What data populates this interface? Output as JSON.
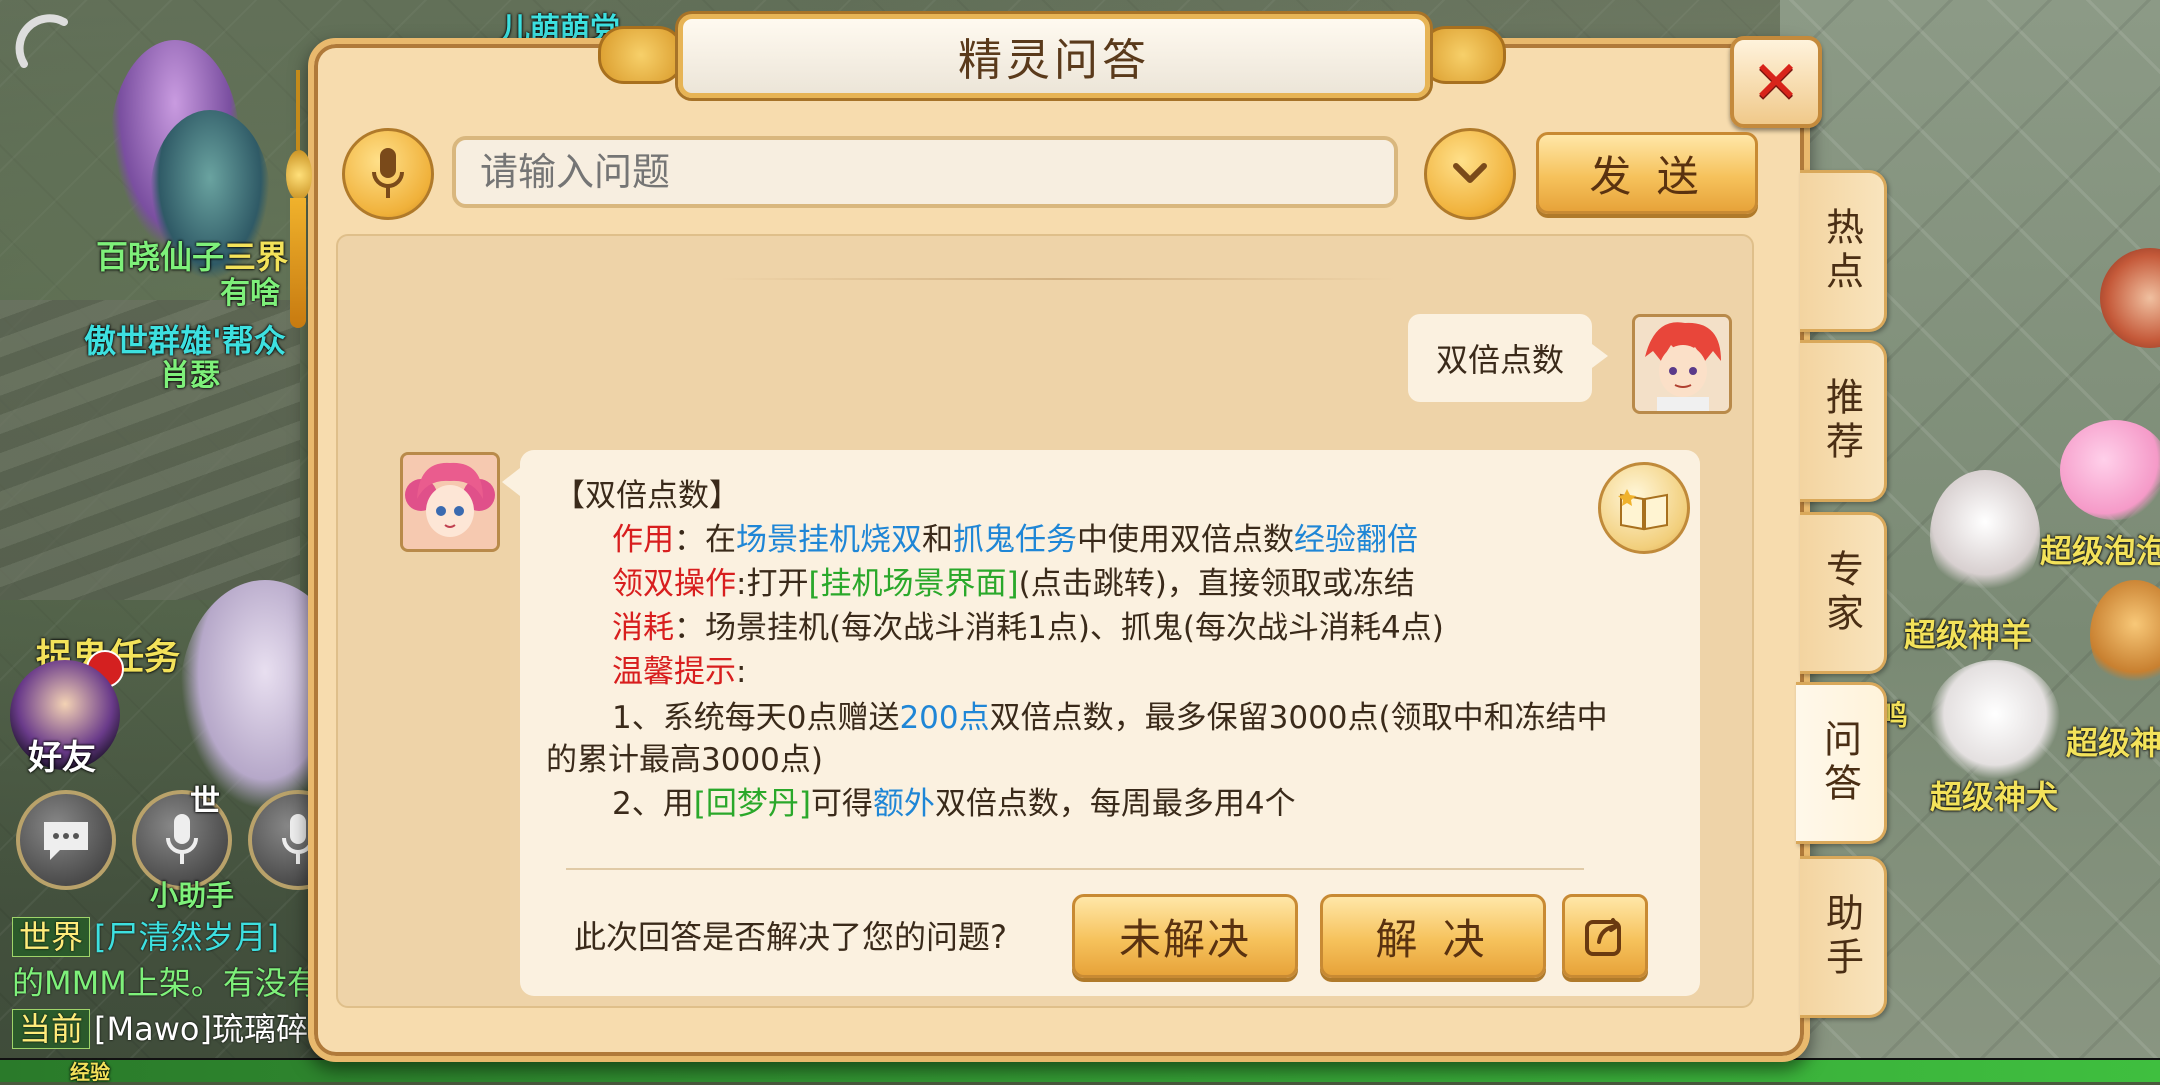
{
  "dialog": {
    "title": "精灵问答",
    "close_label": "✕",
    "search_placeholder": "请输入问题",
    "send_label": "发 送"
  },
  "side_tabs": [
    {
      "label": "热点"
    },
    {
      "label": "推荐"
    },
    {
      "label": "专家"
    },
    {
      "label": "问答"
    },
    {
      "label": "助手"
    }
  ],
  "conversation": {
    "user_message": "双倍点数",
    "answer": {
      "heading": "【双倍点数】",
      "usage_label": "作用",
      "usage_text_1": "：在",
      "usage_link_1": "场景挂机烧双",
      "usage_text_2": "和",
      "usage_link_2": "抓鬼任务",
      "usage_text_3": "中使用双倍点数",
      "usage_link_3": "经验翻倍",
      "claim_label": "领双操作",
      "claim_text_1": ":打开",
      "claim_link": "[挂机场景界面]",
      "claim_text_2": "(点击跳转)，直接领取或冻结",
      "cost_label": "消耗",
      "cost_text": "：场景挂机(每次战斗消耗1点)、抓鬼(每次战斗消耗4点)",
      "tip_label": "温馨提示",
      "tip_colon": ":",
      "tip1_text_1": "1、系统每天0点赠送",
      "tip1_link": "200点",
      "tip1_text_2": "双倍点数，最多保留3000点(领取中和冻结中",
      "tip1_text_3": "的累计最高3000点)",
      "tip2_text_1": "2、用",
      "tip2_item": "[回梦丹]",
      "tip2_text_2": "可得",
      "tip2_link": "额外",
      "tip2_text_3": "双倍点数，每周最多用4个"
    },
    "feedback_question": "此次回答是否解决了您的问题?",
    "unresolved_label": "未解决",
    "resolved_label": "解 决"
  },
  "background": {
    "npc_name_1": "百晓仙子",
    "npc_name_1b": "三界",
    "npc_sub_1": "有啥",
    "guild_name": "傲世群雄'帮众",
    "player_name": "肖瑟",
    "quest_label": "捉鬼任务",
    "friends_label": "好友",
    "world_btn": "世",
    "top_name": "儿萌萌党",
    "pet_1": "超级泡泡",
    "pet_2": "超级神羊",
    "pet_3": "超级神",
    "pet_4": "超级神犬",
    "pet_5": "鸣",
    "chat_1_tag": "世界",
    "chat_1_text": "[尸清然岁月]",
    "chat_2_text": "的MMM上架。有没有",
    "chat_3_tag": "当前",
    "chat_3_text": "[Mawo]琉璃碎",
    "exp_label": "经验",
    "helper_label": "小助手"
  },
  "colors": {
    "dialog_bg": "#f7dcae",
    "accent_gold": "#f6c25c",
    "link_blue": "#1f86d6",
    "label_red": "#d81e1e",
    "item_green": "#2aa82a",
    "close_red": "#d8231a"
  }
}
